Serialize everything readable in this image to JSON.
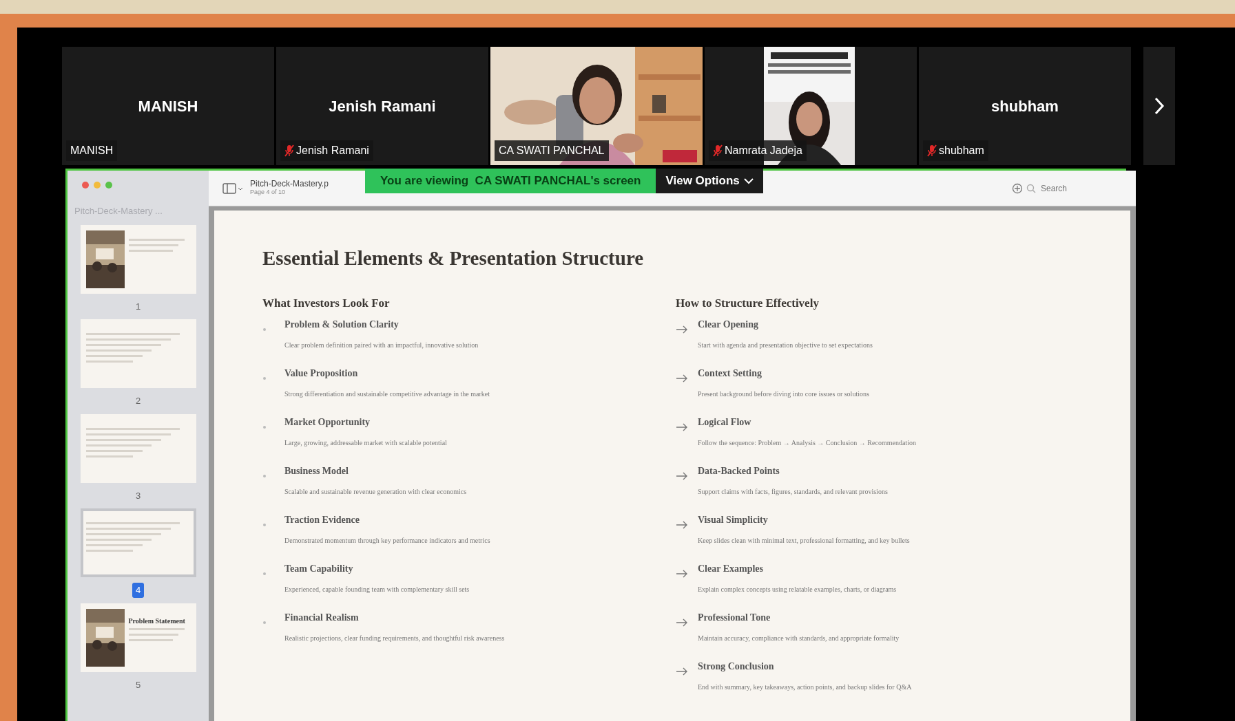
{
  "participants": [
    {
      "tile_name": "MANISH",
      "label": "MANISH",
      "kind": "avatar",
      "muted": false
    },
    {
      "tile_name": "Jenish Ramani",
      "label": "Jenish Ramani",
      "kind": "avatar",
      "muted": true
    },
    {
      "label": "CA SWATI PANCHAL",
      "kind": "video",
      "muted": false
    },
    {
      "label": "Namrata Jadeja",
      "kind": "video",
      "muted": true
    },
    {
      "tile_name": "shubham",
      "label": "shubham",
      "kind": "avatar",
      "muted": true
    }
  ],
  "share_banner": {
    "text": "You are viewing  CA SWATI PANCHAL's screen",
    "button": "View Options"
  },
  "viewer": {
    "sidebar_title": "Pitch-Deck-Mastery ...",
    "file_name": "Pitch-Deck-Mastery.p",
    "page_info": "Page 4 of 10",
    "search": {
      "placeholder": "Search"
    },
    "thumbnails": [
      {
        "number": "1",
        "selected": false
      },
      {
        "number": "2",
        "kind": "text",
        "selected": false
      },
      {
        "number": "3",
        "kind": "text",
        "selected": false
      },
      {
        "number": "4",
        "kind": "text",
        "selected": true
      },
      {
        "number": "5",
        "title": "Problem Statement",
        "selected": false
      }
    ]
  },
  "slide": {
    "title": "Essential Elements & Presentation Structure",
    "columns": [
      {
        "heading": "What Investors Look For",
        "kind": "bullet",
        "items": [
          {
            "title": "Problem & Solution Clarity",
            "text": "Clear problem definition paired with an impactful, innovative solution"
          },
          {
            "title": "Value Proposition",
            "text": "Strong differentiation and sustainable competitive advantage in the market"
          },
          {
            "title": "Market Opportunity",
            "text": "Large, growing, addressable market with scalable potential"
          },
          {
            "title": "Business Model",
            "text": "Scalable and sustainable revenue generation with clear economics"
          },
          {
            "title": "Traction Evidence",
            "text": "Demonstrated momentum through key performance indicators and metrics"
          },
          {
            "title": "Team Capability",
            "text": "Experienced, capable founding team with complementary skill sets"
          },
          {
            "title": "Financial Realism",
            "text": "Realistic projections, clear funding requirements, and thoughtful risk awareness"
          }
        ]
      },
      {
        "heading": "How to Structure Effectively",
        "kind": "arrow",
        "items": [
          {
            "title": "Clear Opening",
            "text": "Start with agenda and presentation objective to set expectations"
          },
          {
            "title": "Context Setting",
            "text": "Present background before diving into core issues or solutions"
          },
          {
            "title": "Logical Flow",
            "text": "Follow the sequence: Problem → Analysis → Conclusion → Recommendation"
          },
          {
            "title": "Data-Backed Points",
            "text": "Support claims with facts, figures, standards, and relevant provisions"
          },
          {
            "title": "Visual Simplicity",
            "text": "Keep slides clean with minimal text, professional formatting, and key bullets"
          },
          {
            "title": "Clear Examples",
            "text": "Explain complex concepts using relatable examples, charts, or diagrams"
          },
          {
            "title": "Professional Tone",
            "text": "Maintain accuracy, compliance with standards, and appropriate formality"
          },
          {
            "title": "Strong Conclusion",
            "text": "End with summary, key takeaways, action points, and backup slides for Q&A"
          }
        ]
      }
    ]
  }
}
